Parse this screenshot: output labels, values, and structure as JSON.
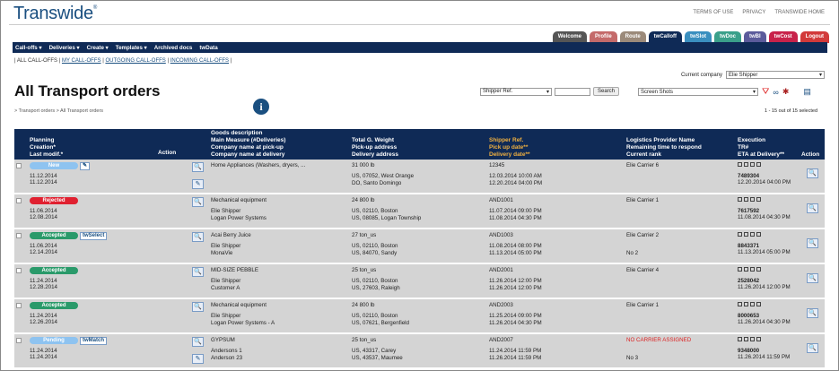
{
  "brand": "Transwide",
  "toplinks": [
    "TERMS OF USE",
    "PRIVACY",
    "TRANSWIDE HOME"
  ],
  "tabs": [
    {
      "label": "Welcome",
      "color": "#555555"
    },
    {
      "label": "Profile",
      "color": "#c46a6a"
    },
    {
      "label": "Route",
      "color": "#9b8a7a"
    },
    {
      "label": "twCalloff",
      "color": "#0f2a56"
    },
    {
      "label": "twSlot",
      "color": "#3a8fbf"
    },
    {
      "label": "twDoc",
      "color": "#3aa08a"
    },
    {
      "label": "twBI",
      "color": "#5b5b9b"
    },
    {
      "label": "twCost",
      "color": "#c8224a"
    },
    {
      "label": "Logout",
      "color": "#d23a3a"
    }
  ],
  "nav": [
    "Call-offs ▾",
    "Deliveries ▾",
    "Create ▾",
    "Templates ▾",
    "Archived docs",
    "twData"
  ],
  "subnav": {
    "all": "ALL CALL-OFFS",
    "my": "MY CALL-OFFS",
    "outgoing": "OUTGOING CALL-OFFS",
    "incoming": "INCOMING CALL-OFFS"
  },
  "company": {
    "label": "Current company",
    "value": "Elie Shipper"
  },
  "title": "All Transport orders",
  "search": {
    "field": "Shipper Ref.",
    "button": "Search"
  },
  "screens": "Screen Shots",
  "breadcrumb": "> Transport orders > All Transport orders",
  "count": "1 - 15 out of 15 selected",
  "headers": {
    "c1": [
      "Planning",
      "Creation*",
      "Last modif.*"
    ],
    "action": "Action",
    "c3": [
      "Goods description",
      "Main Measure (#Deliveries)",
      "Company name at pick-up",
      "Company name at delivery"
    ],
    "c4": [
      "Total G. Weight",
      "Pick-up address",
      "Delivery address"
    ],
    "c5": [
      "Shipper Ref.",
      "Pick up date**",
      "Delivery date**"
    ],
    "c6": [
      "Logistics Provider Name",
      "Remaining time to respond",
      "Current rank"
    ],
    "c7": [
      "Execution",
      "TR#",
      "ETA at Delivery**"
    ],
    "action2": "Action"
  },
  "rows": [
    {
      "status": "New",
      "scolor": "#8ec3f0",
      "tool": "",
      "d1": "11.12.2014",
      "d2": "11.12.2014",
      "g1": "Home Appliances (Washers, dryers, ...",
      "g2": "",
      "g3": "",
      "w1": "31 000 lb",
      "w2": "US, 07052, West Orange",
      "w3": "DO, Santo Domingo",
      "s1": "12345",
      "s2": "12.03.2014 10:00 AM",
      "s3": "12.20.2014 04:00 PM",
      "l1": "Elie Carrier 6",
      "l2": "",
      "l3": "",
      "e1": "7489304",
      "e2": "12.20.2014 04:00 PM"
    },
    {
      "status": "Rejected",
      "scolor": "#e02030",
      "tool": "",
      "d1": "11.06.2014",
      "d2": "12.08.2014",
      "g1": "Mechanical equipment",
      "g2": "Elie Shipper",
      "g3": "Logan Power Systems",
      "w1": "24 800 lb",
      "w2": "US, 02110, Boston",
      "w3": "US, 08085, Logan Township",
      "s1": "AND1001",
      "s2": "11.07.2014 09:00 PM",
      "s3": "11.08.2014 04:30 PM",
      "l1": "Elie Carrier 1",
      "l2": "",
      "l3": "",
      "e1": "7617592",
      "e2": "11.08.2014 04:30 PM"
    },
    {
      "status": "Accepted",
      "scolor": "#2a9a6a",
      "tool": "twSelect",
      "d1": "11.06.2014",
      "d2": "12.14.2014",
      "g1": "Acai Berry Juice",
      "g2": "Elie Shipper",
      "g3": "MonaVie",
      "w1": "27 ton_us",
      "w2": "US, 02110, Boston",
      "w3": "US, 84070, Sandy",
      "s1": "AND1003",
      "s2": "11.08.2014 08:00 PM",
      "s3": "11.13.2014 05:00 PM",
      "l1": "Elie Carrier 2",
      "l2": "",
      "l3": "No 2",
      "e1": "8843371",
      "e2": "11.13.2014 05:00 PM"
    },
    {
      "status": "Accepted",
      "scolor": "#2a9a6a",
      "tool": "",
      "d1": "11.24.2014",
      "d2": "12.28.2014",
      "g1": "MID-SIZE PEBBLE",
      "g2": "Elie Shipper",
      "g3": "Customer A",
      "w1": "25 ton_us",
      "w2": "US, 02110, Boston",
      "w3": "US, 27603, Raleigh",
      "s1": "AND2001",
      "s2": "11.26.2014 12:00 PM",
      "s3": "11.26.2014 12:00 PM",
      "l1": "Elie Carrier 4",
      "l2": "",
      "l3": "",
      "e1": "2528042",
      "e2": "11.26.2014 12:00 PM"
    },
    {
      "status": "Accepted",
      "scolor": "#2a9a6a",
      "tool": "",
      "d1": "11.24.2014",
      "d2": "12.26.2014",
      "g1": "Mechanical equipment",
      "g2": "Elie Shipper",
      "g3": "Logan Power Systems - A",
      "w1": "24 800 lb",
      "w2": "US, 02110, Boston",
      "w3": "US, 07621, Bergenfield",
      "s1": "AND2003",
      "s2": "11.25.2014 09:00 PM",
      "s3": "11.26.2014 04:30 PM",
      "l1": "Elie Carrier 1",
      "l2": "",
      "l3": "",
      "e1": "8000653",
      "e2": "11.26.2014 04:30 PM"
    },
    {
      "status": "Pending",
      "scolor": "#8ec3f0",
      "tool": "twMatch",
      "d1": "11.24.2014",
      "d2": "11.24.2014",
      "g1": "GYPSUM",
      "g2": "Andersons 1",
      "g3": "Anderson 23",
      "w1": "25 ton_us",
      "w2": "US, 43317, Carey",
      "w3": "US, 43537, Maumee",
      "s1": "AND2007",
      "s2": "11.24.2014 11:59 PM",
      "s3": "11.26.2014 11:59 PM",
      "l1": "NO CARRIER ASSIGNED",
      "l2": "",
      "l3": "No 3",
      "e1": "9348000",
      "e2": "11.26.2014 11:59 PM"
    }
  ]
}
